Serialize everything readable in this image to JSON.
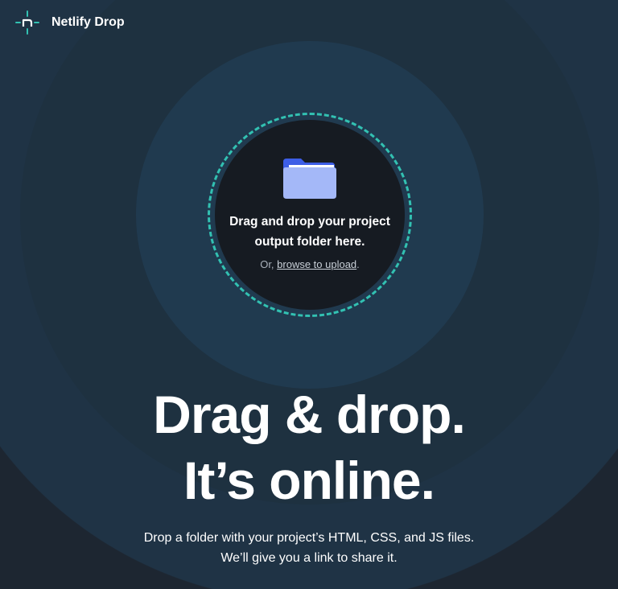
{
  "header": {
    "brand": "Netlify Drop",
    "logo_icon": "netlify-logo-icon"
  },
  "dropzone": {
    "icon": "folder-icon",
    "title": "Drag and drop your project output folder here.",
    "sub_prefix": "Or, ",
    "browse_link": "browse to upload",
    "sub_suffix": "."
  },
  "hero": {
    "line1": "Drag & drop.",
    "line2": "It’s online.",
    "desc_line1": "Drop a folder with your project’s HTML, CSS, and JS files.",
    "desc_line2": "We’ll give you a link to share it."
  },
  "colors": {
    "accent": "#32c1b2",
    "background": "#1d2631",
    "dropzone_bg": "#161b22",
    "folder_front": "#a4b8f8",
    "folder_back": "#3d5ee6"
  }
}
